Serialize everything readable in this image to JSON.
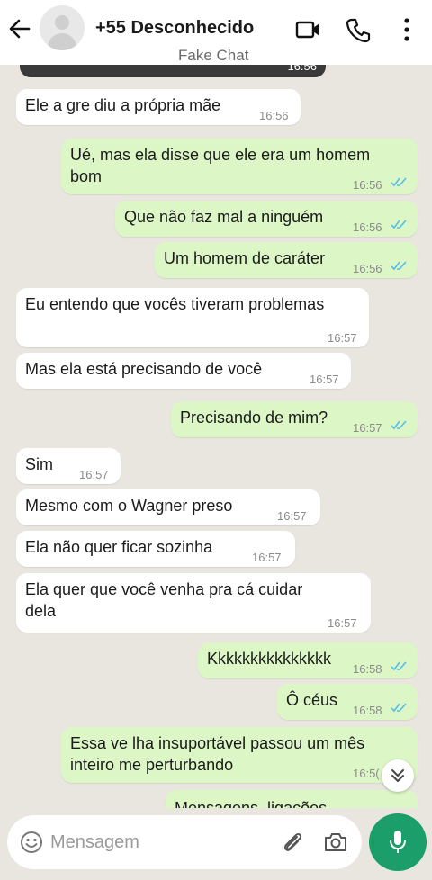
{
  "header": {
    "title": "+55 Desconhecido",
    "subtitle": "Fake Chat",
    "icons": [
      "back-arrow-icon",
      "video-call-icon",
      "phone-icon",
      "more-options-icon"
    ]
  },
  "chat": {
    "image_time": "16:56",
    "messages": [
      {
        "dir": "in",
        "lines": [
          "Ele a gre diu a própria mãe"
        ],
        "time": "16:56"
      },
      {
        "dir": "out",
        "lines": [
          "Ué, mas ela disse que ele era um homem",
          "bom"
        ],
        "time": "16:56"
      },
      {
        "dir": "out",
        "lines": [
          "Que não faz mal a ninguém"
        ],
        "time": "16:56"
      },
      {
        "dir": "out",
        "lines": [
          "Um homem de caráter"
        ],
        "time": "16:56"
      },
      {
        "dir": "in",
        "lines": [
          "Eu entendo que vocês tiveram problemas"
        ],
        "time": "16:57"
      },
      {
        "dir": "in",
        "lines": [
          "Mas ela está precisando de você"
        ],
        "time": "16:57"
      },
      {
        "dir": "out",
        "lines": [
          "Precisando de mim?"
        ],
        "time": "16:57"
      },
      {
        "dir": "in",
        "lines": [
          "Sim"
        ],
        "time": "16:57"
      },
      {
        "dir": "in",
        "lines": [
          "Mesmo com o Wagner preso"
        ],
        "time": "16:57"
      },
      {
        "dir": "in",
        "lines": [
          "Ela não quer ficar sozinha"
        ],
        "time": "16:57"
      },
      {
        "dir": "in",
        "lines": [
          "Ela quer que você venha pra cá cuidar",
          "dela"
        ],
        "time": "16:57"
      },
      {
        "dir": "out",
        "lines": [
          "Kkkkkkkkkkkkkkk"
        ],
        "time": "16:58"
      },
      {
        "dir": "out",
        "lines": [
          "Ô céus"
        ],
        "time": "16:58"
      },
      {
        "dir": "out",
        "lines": [
          "Essa ve lha insuportável passou um mês",
          "inteiro me perturbando"
        ],
        "time": "16:5("
      },
      {
        "dir": "out",
        "lines": [
          "Mensagens, ligações..."
        ],
        "time": ""
      }
    ]
  },
  "composer": {
    "placeholder": "Mensagem",
    "icons": [
      "emoji-icon",
      "attach-icon",
      "camera-icon",
      "mic-icon"
    ]
  },
  "colors": {
    "header_bg": "#ffffff",
    "chat_bg": "#e9e6df",
    "incoming_bubble": "#ffffff",
    "outgoing_bubble": "#dcf7c5",
    "read_ticks": "#53bdeb",
    "mic_button": "#1b9e6a"
  }
}
